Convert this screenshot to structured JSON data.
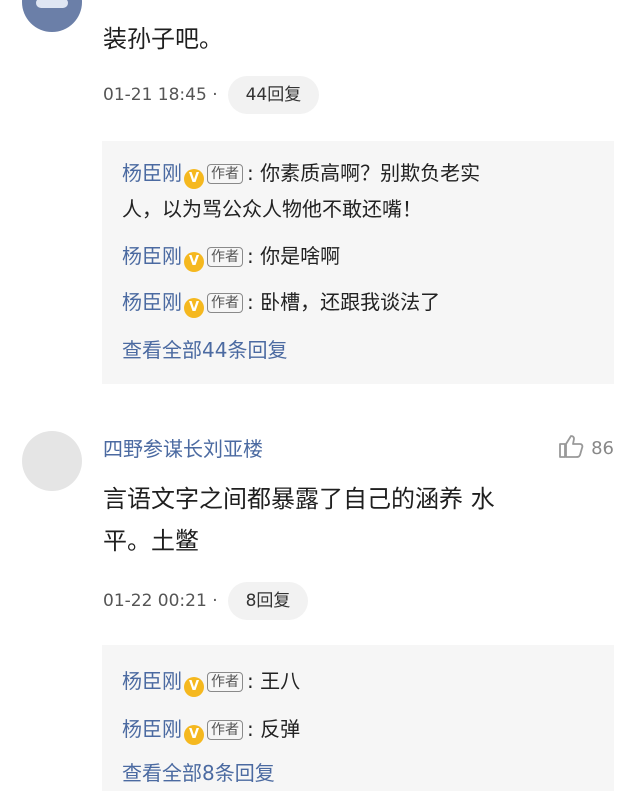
{
  "comments": [
    {
      "text": "装孙子吧。",
      "time": "01-21 18:45 ·",
      "reply_count_label": "44回复",
      "replies": [
        {
          "author": "杨臣刚",
          "tag": "作者",
          "text": ": 你素质高啊？别欺负老实",
          "cont": "人，以为骂公众人物他不敢还嘴！"
        },
        {
          "author": "杨臣刚",
          "tag": "作者",
          "text": ": 你是啥啊"
        },
        {
          "author": "杨臣刚",
          "tag": "作者",
          "text": ": 卧槽，还跟我谈法了"
        }
      ],
      "view_all": "查看全部44条回复"
    },
    {
      "username": "四野参谋长刘亚楼",
      "likes": "86",
      "text_line1": "言语文字之间都暴露了自己的涵养 水",
      "text_line2": "平。土鳖",
      "time": "01-22 00:21 ·",
      "reply_count_label": "8回复",
      "replies": [
        {
          "author": "杨臣刚",
          "tag": "作者",
          "text": ": 王八"
        },
        {
          "author": "杨臣刚",
          "tag": "作者",
          "text": ": 反弹"
        }
      ],
      "view_all": "查看全部8条回复"
    }
  ],
  "colors": {
    "link": "#4b6aa1",
    "verified": "#f5b81f",
    "reply_bg": "#f6f6f6"
  },
  "icons": {
    "verified": "verified-badge-icon",
    "like": "thumbs-up-icon"
  }
}
